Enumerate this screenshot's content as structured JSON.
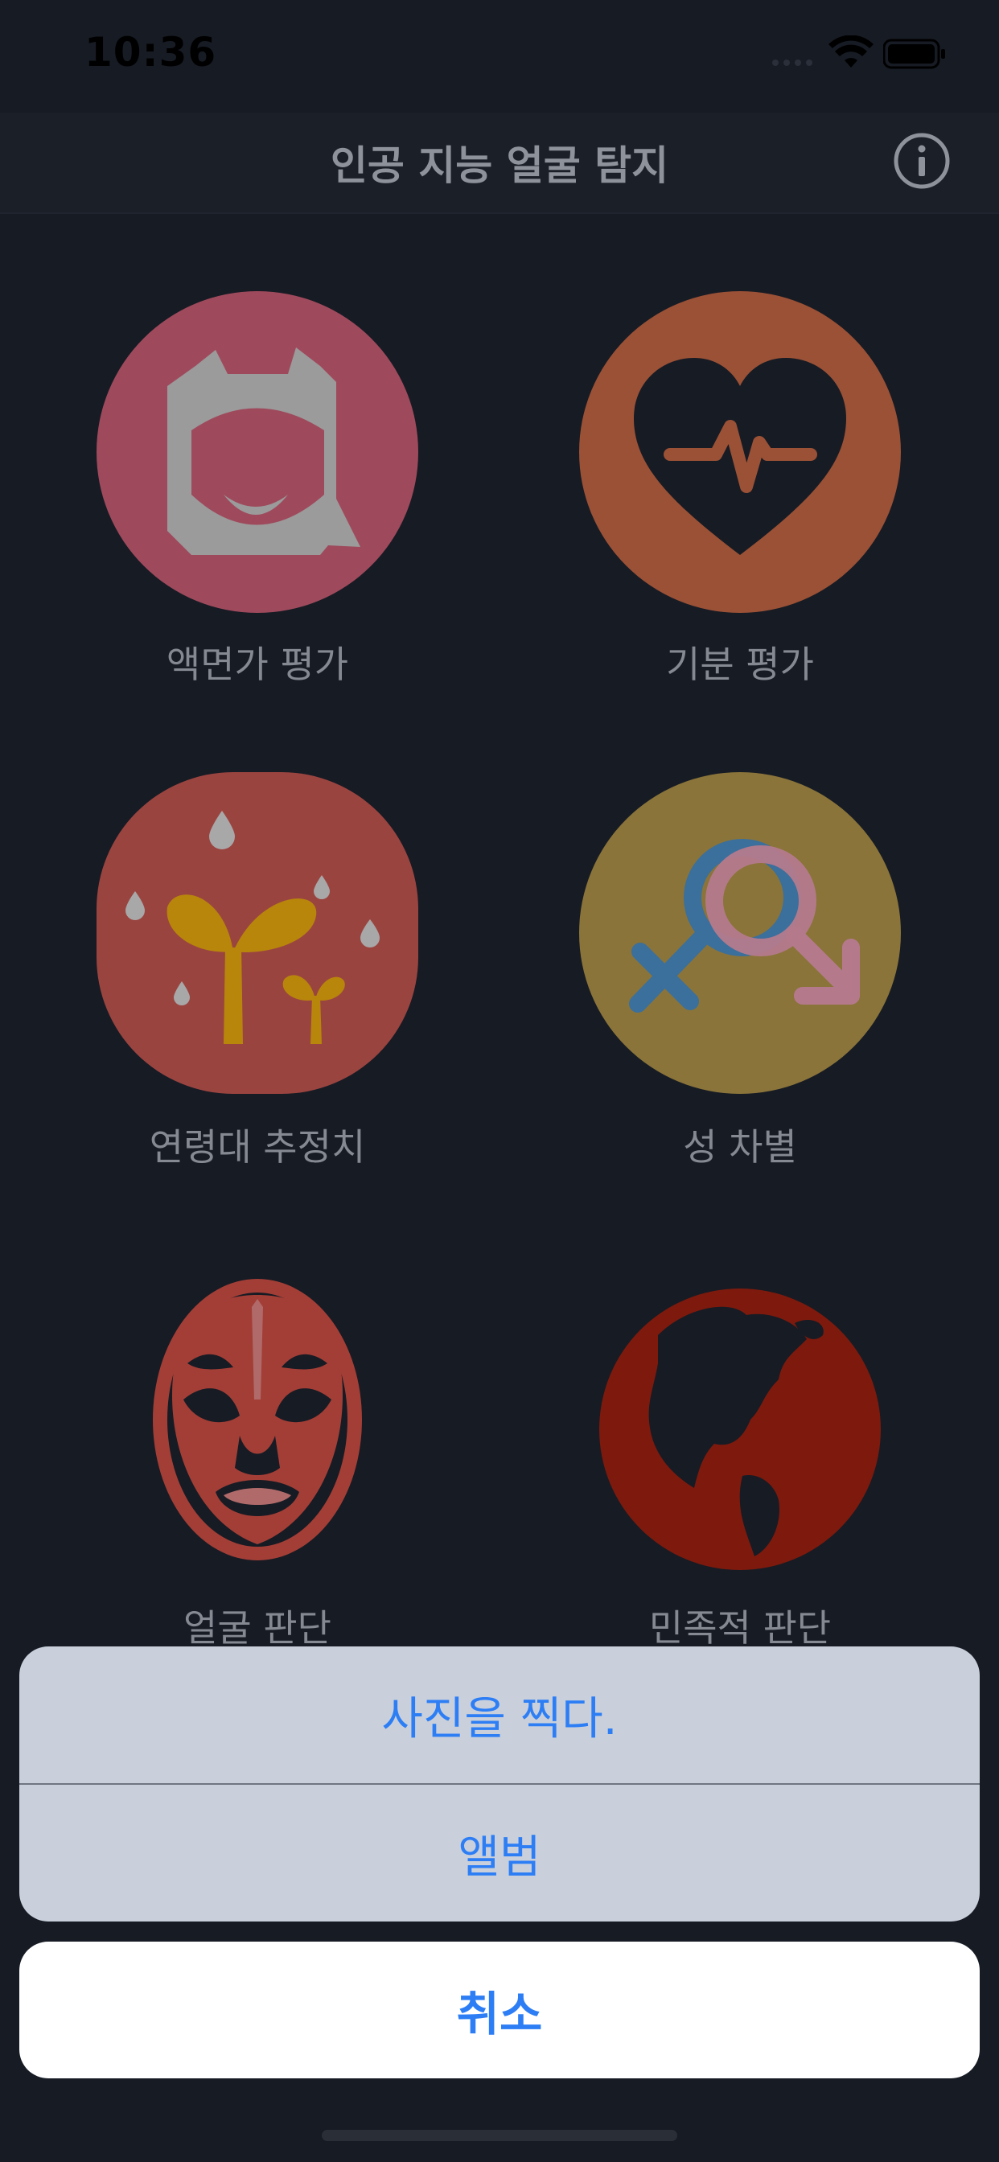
{
  "status_bar": {
    "time": "10:36"
  },
  "nav": {
    "title": "인공 지능 얼굴 탐지",
    "info_icon": "info-circle-icon"
  },
  "features": [
    {
      "label": "액면가 평가",
      "icon": "face-avatar-icon",
      "color": "#9e4a5c"
    },
    {
      "label": "기분 평가",
      "icon": "heart-pulse-icon",
      "color": "#9a5136"
    },
    {
      "label": "연령대 추정치",
      "icon": "sprout-icon",
      "color": "#9a4440"
    },
    {
      "label": "성 차별",
      "icon": "gender-symbols-icon",
      "color": "#8a743a"
    },
    {
      "label": "얼굴 판단",
      "icon": "opera-mask-icon",
      "color": "#a33e36"
    },
    {
      "label": "민족적 판단",
      "icon": "globe-icon",
      "color": "#7d1a0d"
    }
  ],
  "action_sheet": {
    "take_photo": "사진을 찍다.",
    "album": "앨범",
    "cancel": "취소"
  },
  "colors": {
    "background": "#171b24",
    "accent": "#2d7ef5",
    "sheet": "#c9d0db"
  }
}
